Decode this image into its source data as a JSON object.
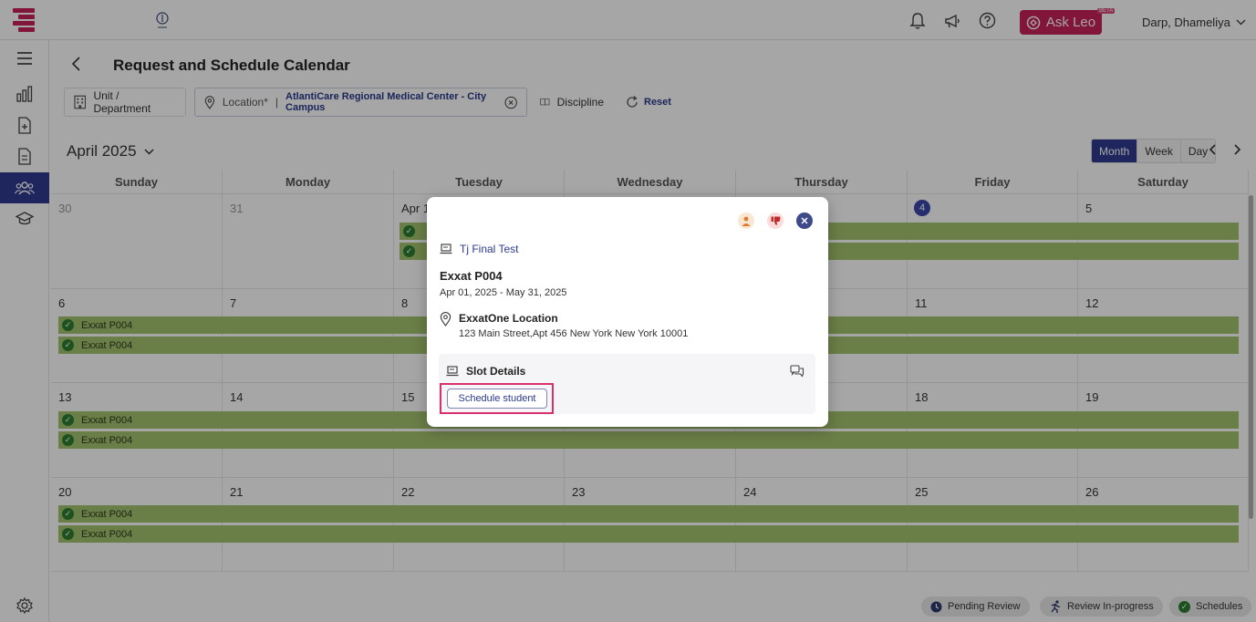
{
  "app": {
    "user_name": "Darp, Dhameliya",
    "ask_leo_label": "Ask Leo",
    "beta_badge": "BETA",
    "brand_color": "#c8215a",
    "accent_color": "#2f3b8f"
  },
  "header": {
    "title": "Request and Schedule Calendar",
    "filters": {
      "unit_label": "Unit / Department",
      "location_label": "Location*",
      "location_separator": "|",
      "location_value": "AtlantiCare Regional Medical Center - City Campus",
      "discipline_label": "Discipline",
      "reset_label": "Reset"
    }
  },
  "calendar": {
    "month_label": "April 2025",
    "views": [
      "Month",
      "Week",
      "Day"
    ],
    "active_view": "Month",
    "weekdays": [
      "Sunday",
      "Monday",
      "Tuesday",
      "Wednesday",
      "Thursday",
      "Friday",
      "Saturday"
    ],
    "weeks": [
      [
        "30",
        "31",
        "Apr 1",
        "",
        "",
        "4",
        "5"
      ],
      [
        "6",
        "7",
        "8",
        "",
        "",
        "11",
        "12"
      ],
      [
        "13",
        "14",
        "15",
        "",
        "",
        "18",
        "19"
      ],
      [
        "20",
        "21",
        "22",
        "23",
        "24",
        "25",
        "26"
      ]
    ],
    "event_label": "Exxat P004"
  },
  "modal": {
    "course_name": "Tj Final Test",
    "title": "Exxat P004",
    "date_range": "Apr 01, 2025 - May 31, 2025",
    "location_name": "ExxatOne Location",
    "location_address": "123 Main Street,Apt 456 New York New York 10001",
    "slot_heading": "Slot Details",
    "schedule_button": "Schedule student"
  },
  "legend": {
    "pending": "Pending Review",
    "in_progress": "Review In-progress",
    "schedules": "Schedules"
  }
}
